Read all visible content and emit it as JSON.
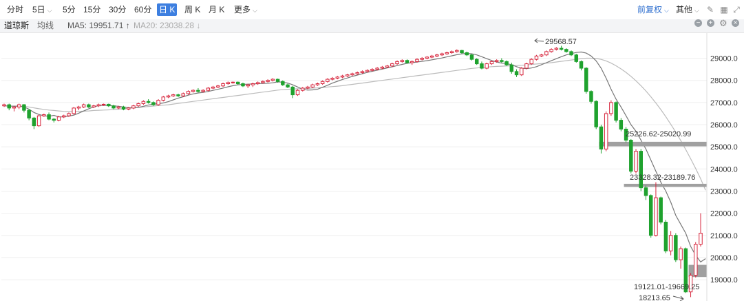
{
  "toolbar": {
    "tabs": [
      {
        "label": "分时",
        "dropdown": false
      },
      {
        "label": "5日",
        "dropdown": true
      },
      {
        "label": "5分",
        "dropdown": false
      },
      {
        "label": "15分",
        "dropdown": false
      },
      {
        "label": "30分",
        "dropdown": false
      },
      {
        "label": "60分",
        "dropdown": false
      },
      {
        "label": "日 K",
        "dropdown": false,
        "active": true
      },
      {
        "label": "周 K",
        "dropdown": false
      },
      {
        "label": "月 K",
        "dropdown": false
      },
      {
        "label": "更多",
        "dropdown": true
      }
    ],
    "adjust_label": "前复权",
    "other_label": "其他",
    "accent_color": "#3d7fe0"
  },
  "infobar": {
    "index_name": "道琼斯",
    "ma_type": "均线",
    "ma5_label": "MA5: 19951.71 ↑",
    "ma20_label": "MA20: 23038.28 ↓"
  },
  "chart_data": {
    "type": "candlestick",
    "title": "",
    "ylim": [
      18100,
      29950
    ],
    "ytick_labels": [
      "29000.0",
      "28000.0",
      "27000.0",
      "26000.0",
      "25000.0",
      "24000.0",
      "23000.0",
      "22000.0",
      "21000.0",
      "20000.0",
      "19000.0"
    ],
    "ytick_values": [
      29000,
      28000,
      27000,
      26000,
      25000,
      24000,
      23000,
      22000,
      21000,
      20000,
      19000
    ],
    "up_color": "#d7263d",
    "down_color": "#1fa22e",
    "ma5_color": "#777777",
    "ma20_color": "#bbbbbb",
    "candles": [
      [
        26850,
        26950,
        26800,
        26900
      ],
      [
        26900,
        26950,
        26650,
        26750
      ],
      [
        26750,
        26850,
        26600,
        26800
      ],
      [
        26800,
        26950,
        26700,
        26900
      ],
      [
        26900,
        26930,
        26550,
        26650
      ],
      [
        26650,
        26700,
        26200,
        26300
      ],
      [
        26300,
        26350,
        25800,
        25950
      ],
      [
        25950,
        26450,
        25900,
        26400
      ],
      [
        26400,
        26500,
        26350,
        26450
      ],
      [
        26450,
        26550,
        26200,
        26250
      ],
      [
        26250,
        26300,
        26100,
        26200
      ],
      [
        26200,
        26400,
        26150,
        26350
      ],
      [
        26350,
        26450,
        26300,
        26400
      ],
      [
        26400,
        26550,
        26350,
        26500
      ],
      [
        26500,
        26800,
        26450,
        26750
      ],
      [
        26750,
        26850,
        26650,
        26800
      ],
      [
        26800,
        26950,
        26750,
        26900
      ],
      [
        26900,
        26950,
        26750,
        26800
      ],
      [
        26800,
        26900,
        26750,
        26850
      ],
      [
        26850,
        26950,
        26800,
        26900
      ],
      [
        26900,
        26950,
        26850,
        26920
      ],
      [
        26920,
        26950,
        26800,
        26850
      ],
      [
        26850,
        26900,
        26700,
        26750
      ],
      [
        26750,
        26850,
        26700,
        26800
      ],
      [
        26800,
        26850,
        26650,
        26700
      ],
      [
        26700,
        26800,
        26650,
        26750
      ],
      [
        26750,
        26900,
        26700,
        26850
      ],
      [
        26850,
        27000,
        26800,
        26950
      ],
      [
        26950,
        27100,
        26900,
        27050
      ],
      [
        27050,
        27150,
        26950,
        27000
      ],
      [
        27000,
        27050,
        26850,
        26900
      ],
      [
        26900,
        27150,
        26850,
        27100
      ],
      [
        27100,
        27300,
        27050,
        27250
      ],
      [
        27250,
        27350,
        27200,
        27300
      ],
      [
        27300,
        27400,
        27250,
        27350
      ],
      [
        27350,
        27400,
        27250,
        27300
      ],
      [
        27300,
        27450,
        27250,
        27400
      ],
      [
        27400,
        27550,
        27350,
        27500
      ],
      [
        27500,
        27600,
        27450,
        27550
      ],
      [
        27550,
        27650,
        27450,
        27500
      ],
      [
        27500,
        27600,
        27450,
        27550
      ],
      [
        27550,
        27700,
        27500,
        27650
      ],
      [
        27650,
        27750,
        27600,
        27700
      ],
      [
        27700,
        27800,
        27650,
        27750
      ],
      [
        27750,
        27900,
        27700,
        27850
      ],
      [
        27850,
        27950,
        27800,
        27900
      ],
      [
        27900,
        27950,
        27850,
        27920
      ],
      [
        27920,
        27950,
        27800,
        27850
      ],
      [
        27850,
        27900,
        27700,
        27750
      ],
      [
        27750,
        27850,
        27650,
        27800
      ],
      [
        27800,
        27900,
        27700,
        27850
      ],
      [
        27850,
        27950,
        27800,
        27900
      ],
      [
        27900,
        28000,
        27850,
        27950
      ],
      [
        27950,
        28050,
        27900,
        28000
      ],
      [
        28000,
        28100,
        27950,
        28050
      ],
      [
        28050,
        28080,
        27900,
        27950
      ],
      [
        27950,
        28000,
        27750,
        27800
      ],
      [
        27800,
        27850,
        27650,
        27700
      ],
      [
        27700,
        27750,
        27200,
        27350
      ],
      [
        27350,
        27600,
        27300,
        27550
      ],
      [
        27550,
        27700,
        27500,
        27650
      ],
      [
        27650,
        27750,
        27600,
        27700
      ],
      [
        27700,
        27850,
        27650,
        27800
      ],
      [
        27800,
        27900,
        27750,
        27850
      ],
      [
        27850,
        28000,
        27800,
        27950
      ],
      [
        27950,
        28100,
        27900,
        28050
      ],
      [
        28050,
        28150,
        28000,
        28100
      ],
      [
        28100,
        28200,
        28050,
        28150
      ],
      [
        28150,
        28250,
        28100,
        28200
      ],
      [
        28200,
        28300,
        28150,
        28250
      ],
      [
        28250,
        28350,
        28200,
        28300
      ],
      [
        28300,
        28400,
        28250,
        28350
      ],
      [
        28350,
        28450,
        28300,
        28400
      ],
      [
        28400,
        28500,
        28350,
        28450
      ],
      [
        28450,
        28550,
        28400,
        28500
      ],
      [
        28500,
        28600,
        28450,
        28550
      ],
      [
        28550,
        28650,
        28500,
        28600
      ],
      [
        28600,
        28700,
        28550,
        28650
      ],
      [
        28650,
        28800,
        28600,
        28750
      ],
      [
        28750,
        28900,
        28700,
        28850
      ],
      [
        28850,
        28950,
        28800,
        28900
      ],
      [
        28900,
        28950,
        28750,
        28800
      ],
      [
        28800,
        28900,
        28700,
        28850
      ],
      [
        28850,
        29000,
        28800,
        28950
      ],
      [
        28950,
        29050,
        28900,
        29000
      ],
      [
        29000,
        29100,
        28950,
        29050
      ],
      [
        29050,
        29150,
        29000,
        29100
      ],
      [
        29100,
        29200,
        29050,
        29150
      ],
      [
        29150,
        29250,
        29100,
        29200
      ],
      [
        29200,
        29300,
        29150,
        29250
      ],
      [
        29250,
        29350,
        29200,
        29300
      ],
      [
        29300,
        29400,
        29250,
        29350
      ],
      [
        29350,
        29380,
        29200,
        29250
      ],
      [
        29250,
        29300,
        29100,
        29150
      ],
      [
        29150,
        29200,
        28900,
        28950
      ],
      [
        28950,
        29000,
        28700,
        28750
      ],
      [
        28750,
        28850,
        28500,
        28550
      ],
      [
        28550,
        28800,
        28500,
        28750
      ],
      [
        28750,
        28900,
        28700,
        28850
      ],
      [
        28850,
        28950,
        28800,
        28900
      ],
      [
        28900,
        29000,
        28800,
        28850
      ],
      [
        28850,
        28900,
        28650,
        28700
      ],
      [
        28700,
        28800,
        28300,
        28400
      ],
      [
        28400,
        28500,
        28150,
        28250
      ],
      [
        28250,
        28600,
        28200,
        28550
      ],
      [
        28550,
        28800,
        28500,
        28750
      ],
      [
        28750,
        29000,
        28700,
        28950
      ],
      [
        28950,
        29150,
        28900,
        29100
      ],
      [
        29100,
        29200,
        29050,
        29150
      ],
      [
        29150,
        29350,
        29100,
        29300
      ],
      [
        29300,
        29450,
        29250,
        29400
      ],
      [
        29400,
        29500,
        29350,
        29450
      ],
      [
        29450,
        29560,
        29350,
        29400
      ],
      [
        29400,
        29450,
        29250,
        29300
      ],
      [
        29300,
        29350,
        29100,
        29150
      ],
      [
        29150,
        29200,
        28800,
        28850
      ],
      [
        28850,
        28900,
        28450,
        28550
      ],
      [
        28550,
        28600,
        27400,
        27500
      ],
      [
        27500,
        27550,
        26950,
        27050
      ],
      [
        27050,
        27100,
        25800,
        25900
      ],
      [
        25900,
        26000,
        24700,
        24900
      ],
      [
        24900,
        26600,
        24800,
        26500
      ],
      [
        26500,
        27100,
        26400,
        27000
      ],
      [
        27000,
        27050,
        26100,
        26200
      ],
      [
        26200,
        26300,
        25700,
        25800
      ],
      [
        25800,
        25900,
        25200,
        25300
      ],
      [
        25300,
        25350,
        23800,
        23900
      ],
      [
        23900,
        24900,
        23800,
        24800
      ],
      [
        24800,
        24900,
        23000,
        23150
      ],
      [
        23150,
        23250,
        22600,
        22800
      ],
      [
        22800,
        22850,
        20900,
        21000
      ],
      [
        21000,
        23400,
        20950,
        22700
      ],
      [
        22700,
        22750,
        21500,
        21600
      ],
      [
        21600,
        21700,
        20200,
        20300
      ],
      [
        20300,
        21200,
        20100,
        21000
      ],
      [
        21000,
        21100,
        19800,
        19900
      ],
      [
        19900,
        20500,
        19500,
        20400
      ],
      [
        20400,
        20450,
        18400,
        18450
      ],
      [
        18450,
        19300,
        18213,
        19200
      ],
      [
        19200,
        20700,
        19100,
        20600
      ],
      [
        20600,
        22000,
        20500,
        21100
      ]
    ],
    "ma5_values": [
      26850,
      26840,
      26830,
      26840,
      26800,
      26700,
      26550,
      26460,
      26400,
      26380,
      26420,
      26350,
      26350,
      26390,
      26430,
      26520,
      26620,
      26720,
      26800,
      26860,
      26870,
      26870,
      26850,
      26830,
      26800,
      26770,
      26760,
      26780,
      26830,
      26890,
      26930,
      26950,
      26980,
      27040,
      27120,
      27200,
      27260,
      27330,
      27390,
      27430,
      27460,
      27500,
      27550,
      27600,
      27650,
      27710,
      27760,
      27800,
      27820,
      27830,
      27840,
      27850,
      27860,
      27870,
      27890,
      27930,
      27920,
      27880,
      27800,
      27700,
      27600,
      27560,
      27570,
      27600,
      27690,
      27780,
      27880,
      27960,
      28040,
      28110,
      28180,
      28240,
      28300,
      28360,
      28410,
      28460,
      28510,
      28560,
      28610,
      28670,
      28720,
      28770,
      28800,
      28830,
      28860,
      28890,
      28930,
      28970,
      29010,
      29060,
      29110,
      29160,
      29200,
      29220,
      29200,
      29150,
      29070,
      28980,
      28900,
      28830,
      28780,
      28760,
      28710,
      28620,
      28550,
      28530,
      28560,
      28620,
      28710,
      28800,
      28890,
      28980,
      29070,
      29150,
      29210,
      29260,
      29280,
      29230,
      29100,
      28880,
      28550,
      28100,
      27600,
      27150,
      26800,
      26400,
      26000,
      25700,
      25300,
      24900,
      24400,
      23900,
      23400,
      23000,
      22500,
      21900,
      21500,
      21100,
      20500,
      20100,
      19800,
      19950
    ],
    "ma20_values": [
      26850,
      26845,
      26840,
      26838,
      26830,
      26800,
      26760,
      26720,
      26690,
      26660,
      26640,
      26620,
      26600,
      26590,
      26590,
      26600,
      26610,
      26620,
      26640,
      26650,
      26660,
      26670,
      26680,
      26700,
      26720,
      26740,
      26760,
      26780,
      26800,
      26820,
      26840,
      26860,
      26880,
      26900,
      26930,
      26960,
      26990,
      27020,
      27050,
      27080,
      27110,
      27140,
      27170,
      27200,
      27230,
      27260,
      27290,
      27320,
      27350,
      27380,
      27410,
      27440,
      27470,
      27500,
      27530,
      27560,
      27580,
      27600,
      27610,
      27620,
      27630,
      27640,
      27650,
      27660,
      27680,
      27700,
      27720,
      27740,
      27760,
      27790,
      27820,
      27850,
      27880,
      27910,
      27940,
      27970,
      28000,
      28030,
      28060,
      28090,
      28120,
      28150,
      28180,
      28210,
      28240,
      28270,
      28300,
      28330,
      28360,
      28390,
      28420,
      28450,
      28480,
      28510,
      28540,
      28560,
      28580,
      28600,
      28620,
      28630,
      28640,
      28650,
      28660,
      28670,
      28680,
      28700,
      28720,
      28740,
      28760,
      28780,
      28800,
      28830,
      28860,
      28890,
      28920,
      28950,
      28980,
      29000,
      29000,
      28990,
      28950,
      28880,
      28780,
      28660,
      28520,
      28360,
      28180,
      27980,
      27760,
      27520,
      27260,
      26980,
      26680,
      26360,
      26020,
      25660,
      25280,
      24880,
      24460,
      24020,
      23560,
      23038
    ]
  },
  "annotations": {
    "high_label": "29568.57",
    "low_label": "18213.65",
    "gap1_label": "25226.62-25020.99",
    "gap2_label": "23328.32-23189.76",
    "gap3_label": "19121.01-19669.25"
  }
}
